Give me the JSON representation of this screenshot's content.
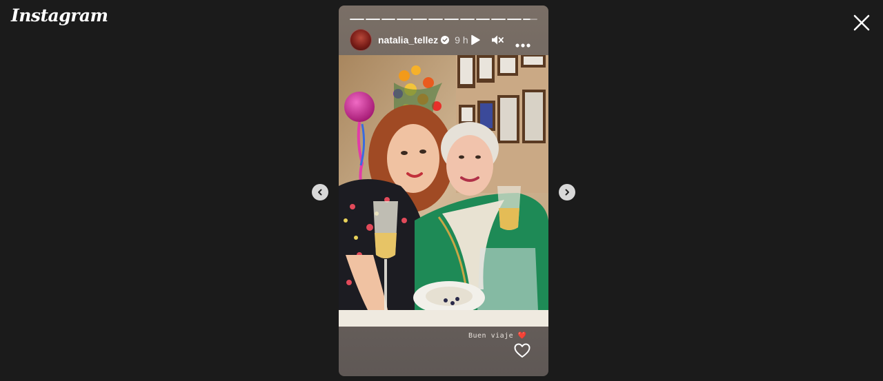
{
  "app": {
    "logo_text": "Instagram"
  },
  "story": {
    "username": "natalia_tellez",
    "verified": true,
    "time_ago": "9 h",
    "caption": "Buen viaje",
    "caption_emoji": "❤️",
    "progress_segments": 12,
    "active_segment": 12
  },
  "icons": {
    "close": "close-icon",
    "prev": "chevron-left-icon",
    "next": "chevron-right-icon",
    "play": "play-icon",
    "mute": "muted-speaker-icon",
    "more": "more-options-icon",
    "verified": "verified-badge-icon",
    "like": "heart-icon"
  },
  "colors": {
    "background": "#1b1b1b",
    "accent_white": "#ffffff",
    "heart_red": "#e0245e"
  }
}
